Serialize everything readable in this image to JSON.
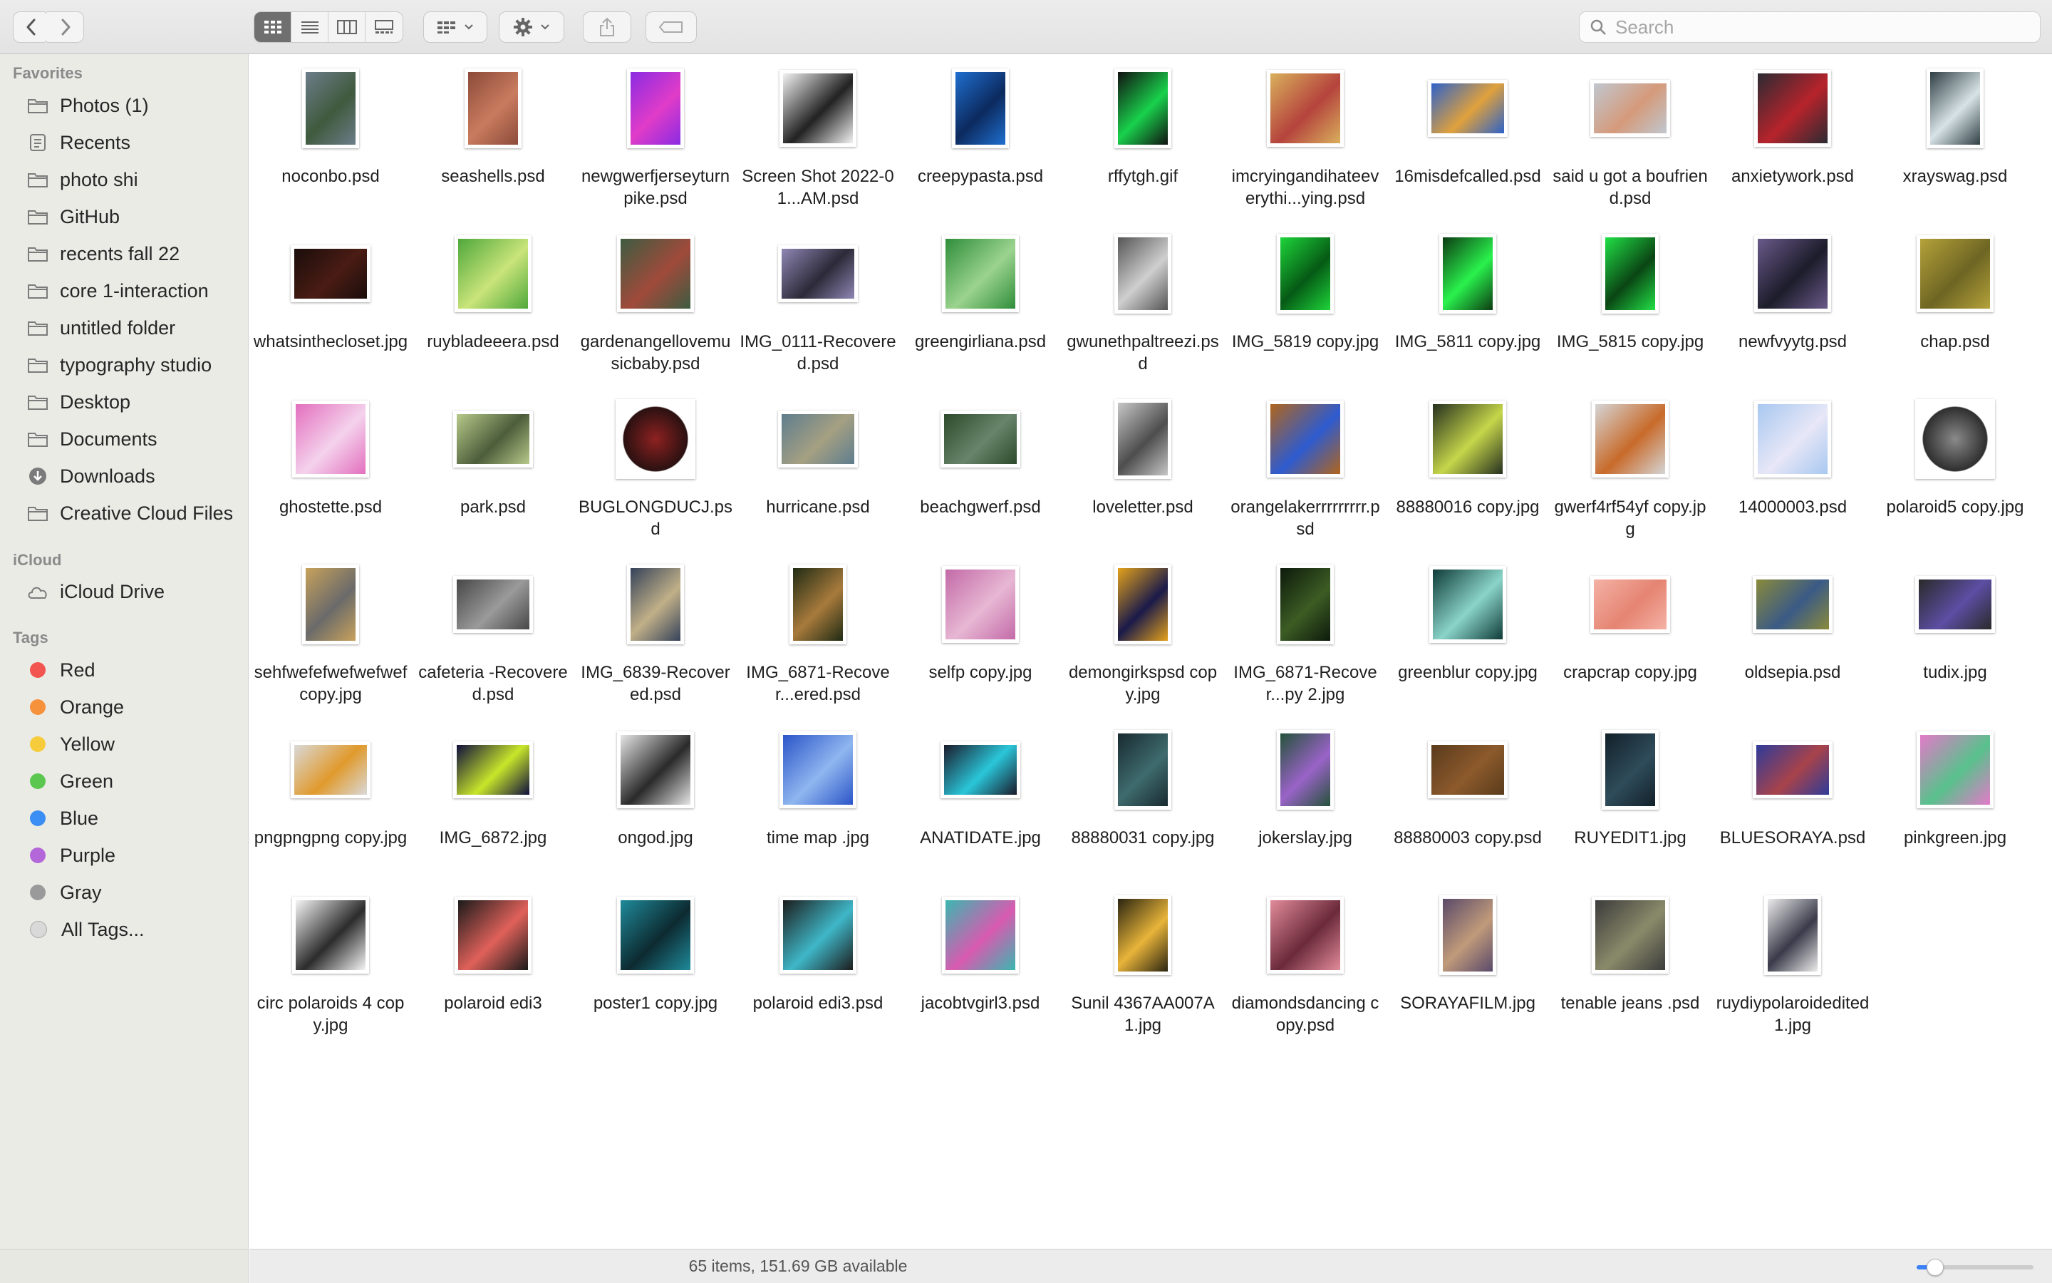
{
  "search": {
    "placeholder": "Search"
  },
  "sidebar": {
    "favorites_header": "Favorites",
    "favorites": [
      {
        "label": "Photos (1)",
        "icon": "folder-icon"
      },
      {
        "label": "Recents",
        "icon": "recents-icon"
      },
      {
        "label": "photo shi",
        "icon": "folder-icon"
      },
      {
        "label": "GitHub",
        "icon": "folder-icon"
      },
      {
        "label": "recents fall 22",
        "icon": "folder-icon"
      },
      {
        "label": "core 1-interaction",
        "icon": "folder-icon"
      },
      {
        "label": "untitled folder",
        "icon": "folder-icon"
      },
      {
        "label": "typography studio",
        "icon": "folder-icon"
      },
      {
        "label": "Desktop",
        "icon": "folder-icon"
      },
      {
        "label": "Documents",
        "icon": "folder-icon"
      },
      {
        "label": "Downloads",
        "icon": "downloads-icon"
      },
      {
        "label": "Creative Cloud Files",
        "icon": "folder-icon"
      }
    ],
    "icloud_header": "iCloud",
    "icloud": [
      {
        "label": "iCloud Drive",
        "icon": "cloud-icon"
      }
    ],
    "tags_header": "Tags",
    "tags": [
      {
        "label": "Red",
        "color": "#f2544f"
      },
      {
        "label": "Orange",
        "color": "#f6913c"
      },
      {
        "label": "Yellow",
        "color": "#f7cc3c"
      },
      {
        "label": "Green",
        "color": "#5bc74f"
      },
      {
        "label": "Blue",
        "color": "#3b8ef3"
      },
      {
        "label": "Purple",
        "color": "#b467d8"
      },
      {
        "label": "Gray",
        "color": "#9a9a9a"
      },
      {
        "label": "All Tags...",
        "color": "#d9d9d9"
      }
    ]
  },
  "files": [
    {
      "name": "noconbo.psd",
      "orient": "portrait",
      "colors": [
        "#6c7d8a",
        "#3f5a3d"
      ]
    },
    {
      "name": "seashells.psd",
      "orient": "portrait",
      "colors": [
        "#8b4b3a",
        "#c97b5e"
      ]
    },
    {
      "name": "newgwerfjerseyturnpike.psd",
      "orient": "portrait",
      "colors": [
        "#8a2be2",
        "#e03cc8"
      ]
    },
    {
      "name": "Screen Shot 2022-01...AM.psd",
      "orient": "square",
      "colors": [
        "#f2f2f2",
        "#222222"
      ]
    },
    {
      "name": "creepypasta.psd",
      "orient": "portrait",
      "colors": [
        "#1f6fd0",
        "#0c2a5e"
      ]
    },
    {
      "name": "rffytgh.gif",
      "orient": "portrait",
      "colors": [
        "#111111",
        "#19d14c"
      ]
    },
    {
      "name": "imcryingandihateeverythi...ying.psd",
      "orient": "square",
      "colors": [
        "#d9b05c",
        "#b5433d"
      ]
    },
    {
      "name": "16misdefcalled.psd",
      "orient": "landscape",
      "colors": [
        "#2d62c9",
        "#e0a13c"
      ]
    },
    {
      "name": "said u got a boufriend.psd",
      "orient": "landscape",
      "colors": [
        "#c0c7d0",
        "#d59a7a"
      ]
    },
    {
      "name": "anxietywork.psd",
      "orient": "square",
      "colors": [
        "#2b2b33",
        "#b7232b"
      ]
    },
    {
      "name": "xrayswag.psd",
      "orient": "portrait",
      "colors": [
        "#2f3f44",
        "#d8e3e6"
      ]
    },
    {
      "name": "whatsinthecloset.jpg",
      "orient": "landscape",
      "colors": [
        "#1a0d0b",
        "#4a1c14"
      ]
    },
    {
      "name": "ruybladeeera.psd",
      "orient": "square",
      "colors": [
        "#4fa83b",
        "#c9e47a"
      ]
    },
    {
      "name": "gardenangellovemusicbaby.psd",
      "orient": "square",
      "colors": [
        "#3d5c41",
        "#a04a3b"
      ]
    },
    {
      "name": "IMG_0111-Recovered.psd",
      "orient": "landscape",
      "colors": [
        "#8f86b4",
        "#2c2a38"
      ]
    },
    {
      "name": "greengirliana.psd",
      "orient": "square",
      "colors": [
        "#2f8e3a",
        "#9bd38e"
      ]
    },
    {
      "name": "gwunethpaltreezi.psd",
      "orient": "portrait",
      "colors": [
        "#555555",
        "#cfcfcf"
      ]
    },
    {
      "name": "IMG_5819 copy.jpg",
      "orient": "portrait",
      "colors": [
        "#1ed43a",
        "#065a15"
      ]
    },
    {
      "name": "IMG_5811 copy.jpg",
      "orient": "portrait",
      "colors": [
        "#0c3b12",
        "#2af24d"
      ]
    },
    {
      "name": "IMG_5815 copy.jpg",
      "orient": "portrait",
      "colors": [
        "#22e046",
        "#0a4514"
      ]
    },
    {
      "name": "newfvyytg.psd",
      "orient": "square",
      "colors": [
        "#6a5a8a",
        "#1c1c2a"
      ]
    },
    {
      "name": "chap.psd",
      "orient": "square",
      "colors": [
        "#b5a23a",
        "#6d6523"
      ]
    },
    {
      "name": "ghostette.psd",
      "orient": "square",
      "colors": [
        "#e36fbe",
        "#f4d2ec"
      ]
    },
    {
      "name": "park.psd",
      "orient": "landscape",
      "colors": [
        "#b7c98a",
        "#4c5d3a"
      ]
    },
    {
      "name": "BUGLONGDUCJ.psd",
      "orient": "circle",
      "colors": [
        "#2b1111",
        "#8e2121"
      ]
    },
    {
      "name": "hurricane.psd",
      "orient": "landscape",
      "colors": [
        "#5e7d8e",
        "#a5a082"
      ]
    },
    {
      "name": "beachgwerf.psd",
      "orient": "landscape",
      "colors": [
        "#2e4a2c",
        "#68846a"
      ]
    },
    {
      "name": "loveletter.psd",
      "orient": "portrait",
      "colors": [
        "#c7c7c7",
        "#4d4d4d"
      ]
    },
    {
      "name": "orangelakerrrrrrrrr.psd",
      "orient": "square",
      "colors": [
        "#b0651c",
        "#2e5bd0"
      ]
    },
    {
      "name": "88880016 copy.jpg",
      "orient": "square",
      "colors": [
        "#25301f",
        "#c6d64a"
      ]
    },
    {
      "name": "gwerf4rf54yf copy.jpg",
      "orient": "square",
      "colors": [
        "#d5d5d5",
        "#c86a2a"
      ]
    },
    {
      "name": "14000003.psd",
      "orient": "square",
      "colors": [
        "#a8c8f0",
        "#e7e7f7"
      ]
    },
    {
      "name": "polaroid5 copy.jpg",
      "orient": "circle",
      "colors": [
        "#2f2f2f",
        "#8a8a8a"
      ]
    },
    {
      "name": "sehfwefefwefwefwef copy.jpg",
      "orient": "portrait",
      "colors": [
        "#c8a25c",
        "#6a6a6a"
      ]
    },
    {
      "name": "cafeteria -Recovered.psd",
      "orient": "landscape",
      "colors": [
        "#474747",
        "#9a9a9a"
      ]
    },
    {
      "name": "IMG_6839-Recovered.psd",
      "orient": "portrait",
      "colors": [
        "#35425a",
        "#c1b088"
      ]
    },
    {
      "name": "IMG_6871-Recover...ered.psd",
      "orient": "portrait",
      "colors": [
        "#1f2b14",
        "#a87a3c"
      ]
    },
    {
      "name": "selfp copy.jpg",
      "orient": "square",
      "colors": [
        "#c36aa8",
        "#e7b7d3"
      ]
    },
    {
      "name": "demongirkspsd copy.jpg",
      "orient": "portrait",
      "colors": [
        "#e4a21b",
        "#1a1a4a"
      ]
    },
    {
      "name": "IMG_6871-Recover...py 2.jpg",
      "orient": "portrait",
      "colors": [
        "#0d1a0b",
        "#3c5c24"
      ]
    },
    {
      "name": "greenblur copy.jpg",
      "orient": "square",
      "colors": [
        "#0f3b38",
        "#8ad4c9"
      ]
    },
    {
      "name": "crapcrap copy.jpg",
      "orient": "landscape",
      "colors": [
        "#f4b2a5",
        "#e58472"
      ]
    },
    {
      "name": "oldsepia.psd",
      "orient": "landscape",
      "colors": [
        "#8a8a3a",
        "#3a5a86"
      ]
    },
    {
      "name": "tudix.jpg",
      "orient": "landscape",
      "colors": [
        "#2a2a2a",
        "#5d4ea4"
      ]
    },
    {
      "name": "pngpngpng copy.jpg",
      "orient": "landscape",
      "colors": [
        "#d9d9d9",
        "#e09a2c"
      ]
    },
    {
      "name": "IMG_6872.jpg",
      "orient": "landscape",
      "colors": [
        "#0e0e3c",
        "#c8e62a"
      ]
    },
    {
      "name": "ongod.jpg",
      "orient": "square",
      "colors": [
        "#e5e5e5",
        "#2a2a2a"
      ]
    },
    {
      "name": "time map .jpg",
      "orient": "square",
      "colors": [
        "#2b55c9",
        "#8fb6ef"
      ]
    },
    {
      "name": "ANATIDATE.jpg",
      "orient": "landscape",
      "colors": [
        "#1a1a2a",
        "#2ac6d9"
      ]
    },
    {
      "name": "88880031 copy.jpg",
      "orient": "portrait",
      "colors": [
        "#182a30",
        "#3f6b6e"
      ]
    },
    {
      "name": "jokerslay.jpg",
      "orient": "portrait",
      "colors": [
        "#24523a",
        "#9a63c8"
      ]
    },
    {
      "name": "88880003 copy.psd",
      "orient": "landscape",
      "colors": [
        "#5a3b1c",
        "#8c5a2c"
      ]
    },
    {
      "name": "RUYEDIT1.jpg",
      "orient": "portrait",
      "colors": [
        "#12202a",
        "#2f4c5a"
      ]
    },
    {
      "name": "BLUESORAYA.psd",
      "orient": "landscape",
      "colors": [
        "#2d3b9a",
        "#a8434a"
      ]
    },
    {
      "name": "pinkgreen.jpg",
      "orient": "square",
      "colors": [
        "#e47ac9",
        "#58c18c"
      ]
    },
    {
      "name": "circ polaroids 4 copy.jpg",
      "orient": "square",
      "colors": [
        "#f5f5f5",
        "#2c2c2c"
      ]
    },
    {
      "name": "polaroid edi3",
      "orient": "square",
      "colors": [
        "#1a1a1a",
        "#e0615a"
      ]
    },
    {
      "name": "poster1 copy.jpg",
      "orient": "square",
      "colors": [
        "#1f8a9a",
        "#0d2a30"
      ]
    },
    {
      "name": "polaroid edi3.psd",
      "orient": "square",
      "colors": [
        "#1c1c1c",
        "#3fb7c8"
      ]
    },
    {
      "name": "jacobtvgirl3.psd",
      "orient": "square",
      "colors": [
        "#3ab7b0",
        "#d85ab0"
      ]
    },
    {
      "name": "Sunil 4367AA007A1.jpg",
      "orient": "portrait",
      "colors": [
        "#2a2410",
        "#e8b43a"
      ]
    },
    {
      "name": "diamondsdancing copy.psd",
      "orient": "square",
      "colors": [
        "#e28b9a",
        "#6a2a3a"
      ]
    },
    {
      "name": "SORAYAFILM.jpg",
      "orient": "portrait",
      "colors": [
        "#5a4a6a",
        "#c09a7a"
      ]
    },
    {
      "name": "tenable jeans .psd",
      "orient": "square",
      "colors": [
        "#3c3c3c",
        "#8a8a6a"
      ]
    },
    {
      "name": "ruydiypolaroidedited1.jpg",
      "orient": "portrait",
      "colors": [
        "#ececec",
        "#3a3a4a"
      ]
    }
  ],
  "status": {
    "text": "65 items, 151.69 GB available",
    "icon_size": 0.15
  }
}
